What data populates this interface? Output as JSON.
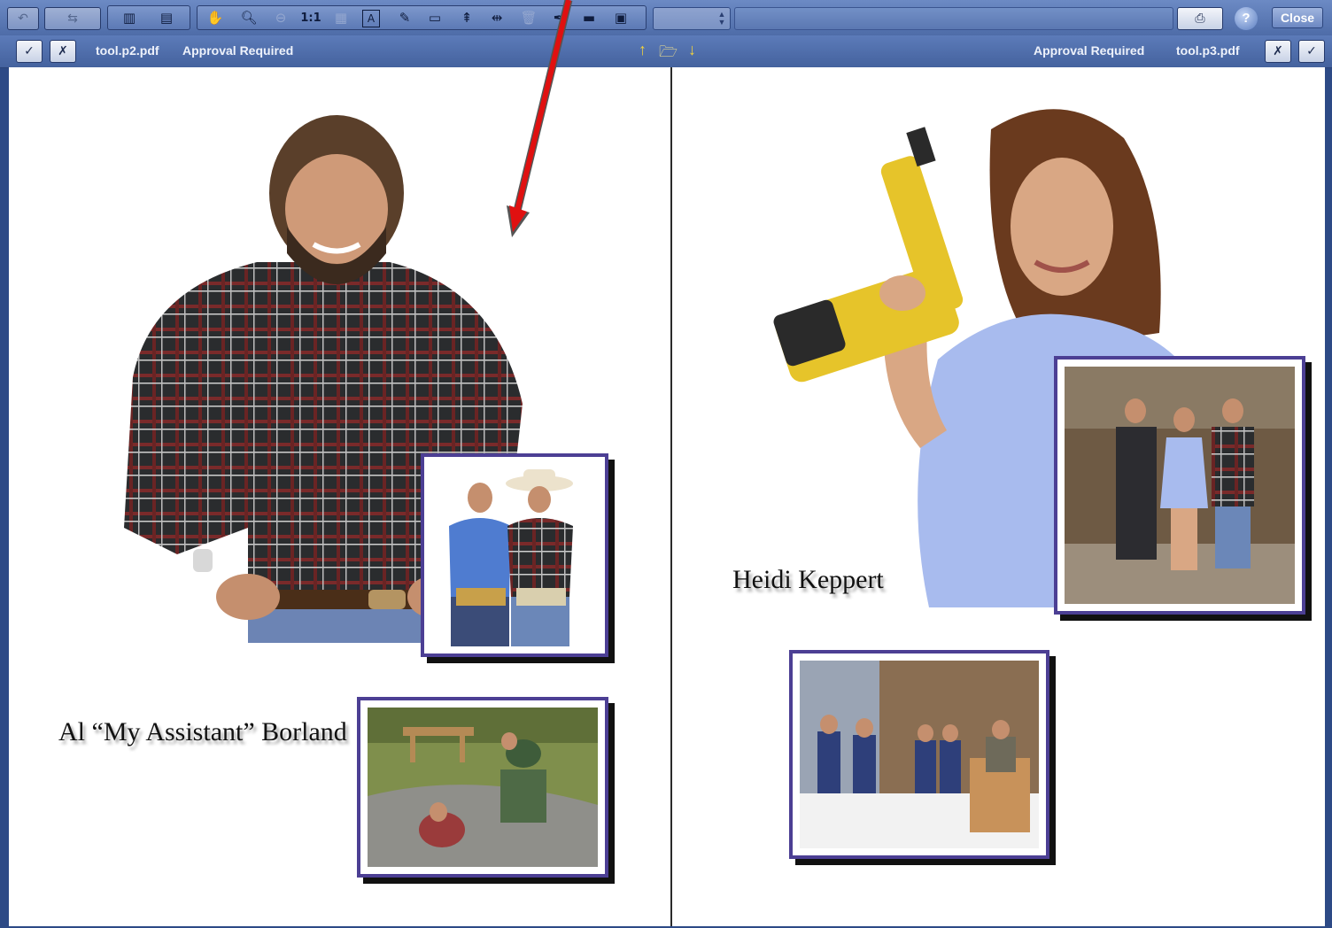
{
  "toolbar_top": {
    "page_field_placeholder": "",
    "help_label": "?",
    "close_label": "Close",
    "tools": {
      "zoom_ratio_label": "1:1",
      "text_tool_label": "A"
    }
  },
  "toolbar_compare": {
    "left": {
      "file_name": "tool.p2.pdf",
      "status": "Approval Required"
    },
    "right": {
      "file_name": "tool.p3.pdf",
      "status": "Approval Required"
    }
  },
  "pages": {
    "left": {
      "caption": "Al “My Assistant” Borland"
    },
    "right": {
      "caption": "Heidi Keppert"
    }
  },
  "icons": [
    "back-icon",
    "forward-icon",
    "dual-page-icon",
    "single-page-icon",
    "hand-icon",
    "zoom-in-icon",
    "zoom-out-icon",
    "fit-icon",
    "text-tool-icon",
    "pencil-icon",
    "rectangle-icon",
    "horizontal-split-icon",
    "vertical-split-icon",
    "trash-icon",
    "pen-icon",
    "ruler-icon",
    "note-icon",
    "print-icon",
    "help-icon",
    "approve-icon",
    "reject-icon",
    "arrow-up-icon",
    "folder-open-icon",
    "arrow-down-icon"
  ],
  "colors": {
    "toolbar": "#5a78b4",
    "frame_border": "#4c3f94",
    "annotation_arrow": "#e01010",
    "nav_arrows": "#f2d23b"
  }
}
